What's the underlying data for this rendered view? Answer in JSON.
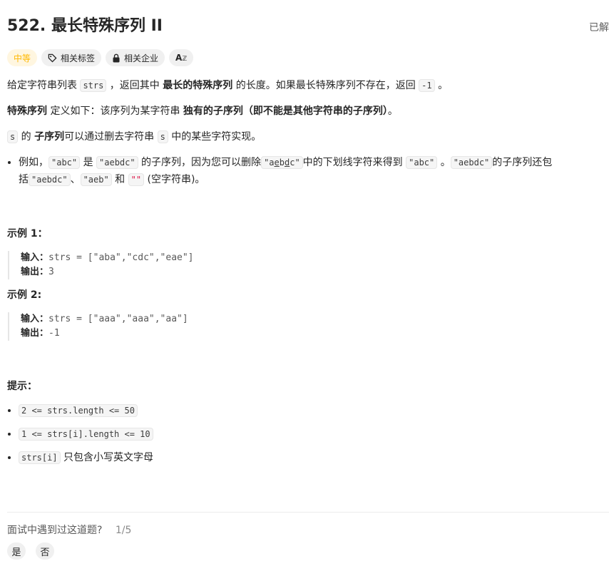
{
  "header": {
    "title": "522. 最长特殊序列 II",
    "status": "已解"
  },
  "tags": {
    "difficulty": "中等",
    "related_tags": "相关标签",
    "related_companies": "相关企业",
    "translate_icon_text": "A"
  },
  "description": {
    "p1": {
      "a": "给定字符串列表 ",
      "code1": "strs",
      "b": " ，返回其中 ",
      "bold1": "最长的特殊序列",
      "c": " 的长度。如果最长特殊序列不存在，返回 ",
      "code2": "-1",
      "d": " 。"
    },
    "p2": {
      "bold1": "特殊序列",
      "a": " 定义如下：该序列为某字符串 ",
      "bold2": "独有的子序列（即不能是其他字符串的子序列）",
      "b": "。"
    },
    "p3": {
      "code1": "s",
      "a": " 的 ",
      "bold1": "子序列",
      "b": "可以通过删去字符串 ",
      "code2": "s",
      "c": " 中的某些字符实现。"
    },
    "bullet": {
      "a": "例如，",
      "code1": "\"abc\"",
      "b": " 是 ",
      "code2": "\"aebdc\"",
      "c": " 的子序列，因为您可以删除",
      "code3_pre": "\"a",
      "code3_u1": "e",
      "code3_mid": "b",
      "code3_u2": "d",
      "code3_post": "c\"",
      "d": "中的下划线字符来得到 ",
      "code4": "\"abc\"",
      "e": " 。",
      "code5": "\"aebdc\"",
      "f": "的子序列还包括",
      "code6": "\"aebdc\"",
      "g": "、",
      "code7": "\"aeb\"",
      "h": " 和 ",
      "code8": "\"\"",
      "i": " (空字符串)。"
    }
  },
  "examples": [
    {
      "title": "示例 1：",
      "input_label": "输入：",
      "input": "strs = [\"aba\",\"cdc\",\"eae\"]",
      "output_label": "输出：",
      "output": "3"
    },
    {
      "title": "示例 2:",
      "input_label": "输入：",
      "input": "strs = [\"aaa\",\"aaa\",\"aa\"]",
      "output_label": "输出：",
      "output": "-1"
    }
  ],
  "constraints": {
    "title": "提示：",
    "items": [
      {
        "code": "2 <= strs.length <= 50",
        "text": ""
      },
      {
        "code": "1 <= strs[i].length <= 10",
        "text": ""
      },
      {
        "code": "strs[i]",
        "text": " 只包含小写英文字母"
      }
    ]
  },
  "feedback": {
    "question": "面试中遇到过这道题?",
    "count": "1/5",
    "yes": "是",
    "no": "否"
  }
}
